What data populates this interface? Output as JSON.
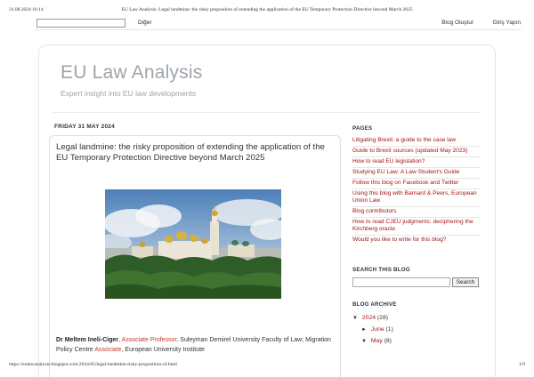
{
  "print": {
    "datetime": "31.08.2024 16:14",
    "title": "EU Law Analysis: Legal landmine: the risky proposition of extending the application of the EU Temporary Protection Directive beyond March 2025",
    "url": "https://eulawanalysis.blogspot.com/2024/05/legal-landmine-risky-proposition-of.html",
    "page": "1/9"
  },
  "navbar": {
    "search_value": "",
    "next_label": "Diğer",
    "create_label": "Blog Oluştur",
    "signin_label": "Giriş Yapın"
  },
  "blog": {
    "title": "EU Law Analysis",
    "description": "Expert insight into EU law developments"
  },
  "post": {
    "date": "FRIDAY 31 MAY 2024",
    "title": "Legal landmine: the risky proposition of extending the application of the EU Temporary Protection Directive beyond March 2025",
    "image_alt": "Kyiv Pechersk Lavra",
    "author": "Dr Meltem Ineli-Ciger",
    "author_sep": ",",
    "role": "Associate Professor",
    "affil1": ", Suleyman Demirel University Faculty of Law; Migration Policy Centre ",
    "affil_link": "Associate",
    "affil2": ", European University Institute"
  },
  "sidebar": {
    "pages_heading": "PAGES",
    "pages": [
      "Litigating Brexit: a guide to the case law",
      "Guide to Brexit sources (updated May 2023)",
      "How to read EU legislation?",
      "Studying EU Law: A Law Student's Guide",
      "Follow this blog on Facebook and Twitter",
      "Using this blog with Barnard & Peers, European Union Law",
      "Blog contributors",
      "How to read CJEU judgments: deciphering the Kirchberg oracle",
      "Would you like to write for this blog?"
    ],
    "search_heading": "SEARCH THIS BLOG",
    "search_value": "",
    "search_button": "Search",
    "archive_heading": "BLOG ARCHIVE",
    "archive": {
      "year": "2024",
      "year_count": "(28)",
      "month1": "June",
      "month1_count": "(1)",
      "month2": "May",
      "month2_count": "(8)",
      "expanded_glyph": "▼",
      "collapsed_glyph": "►"
    }
  },
  "colors": {
    "link": "#a31515",
    "title_grey": "#9ea4aa",
    "text": "#333333"
  }
}
